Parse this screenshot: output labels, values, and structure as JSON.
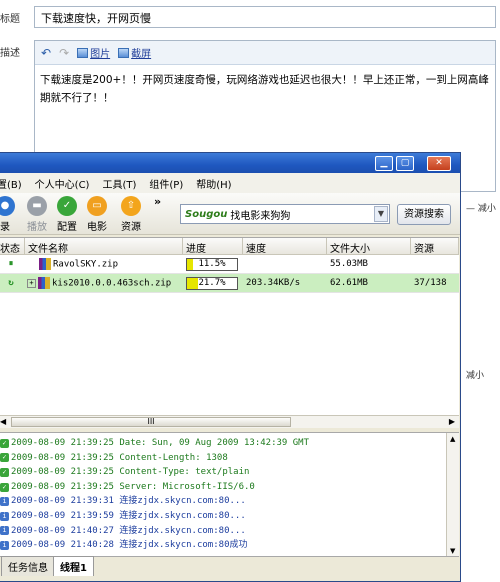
{
  "form": {
    "title_label": "标题",
    "title_value": "下载速度快，开网页慢",
    "desc_label": "描述",
    "image_link": "图片",
    "screenshot_link": "截屏",
    "desc_text": "下载速度是200+！！开网页速度奇慢，玩网络游戏也延迟也很大！！早上还正常，一到上网高峰期就不行了！！",
    "side_note_1": "— 减小",
    "side_note_2": "减小"
  },
  "window": {
    "menu": [
      "置(B)",
      "个人中心(C)",
      "工具(T)",
      "组件(P)",
      "帮助(H)"
    ],
    "toolbar": {
      "tools": [
        {
          "label": "录",
          "icon": "record-icon",
          "color": "#2f74d0"
        },
        {
          "label": "播放",
          "icon": "play-icon",
          "color": "#9aa0a8"
        },
        {
          "label": "配置",
          "icon": "config-icon",
          "color": "#39a63a"
        },
        {
          "label": "电影",
          "icon": "movie-icon",
          "color": "#f0a020"
        },
        {
          "label": "资源",
          "icon": "resource-icon",
          "color": "#f3a51c"
        }
      ],
      "more": "»",
      "search_brand": "Sougou",
      "search_text": "找电影来狗狗",
      "search_button": "资源搜索"
    },
    "columns": [
      "状态",
      "文件名称",
      "进度",
      "速度",
      "文件大小",
      "资源"
    ],
    "rows": [
      {
        "status": "⏸",
        "name": "RavolSKY.zip",
        "progress_text": "11.5%",
        "progress": 11.5,
        "speed": "",
        "size": "55.03MB",
        "sources": "",
        "selected": false
      },
      {
        "status": "↻",
        "name": "kis2010.0.0.463sch.zip",
        "progress_text": "21.7%",
        "progress": 21.7,
        "speed": "203.34KB/s",
        "size": "62.61MB",
        "sources": "37/138",
        "selected": true
      }
    ],
    "scroll_grip": "III",
    "log": [
      {
        "type": "green",
        "text": "2009-08-09 21:39:25 Date: Sun, 09 Aug 2009 13:42:39 GMT"
      },
      {
        "type": "green",
        "text": "2009-08-09 21:39:25 Content-Length: 1308"
      },
      {
        "type": "green",
        "text": "2009-08-09 21:39:25 Content-Type: text/plain"
      },
      {
        "type": "green",
        "text": "2009-08-09 21:39:25 Server: Microsoft-IIS/6.0"
      },
      {
        "type": "blue",
        "text": "2009-08-09 21:39:31 连接zjdx.skycn.com:80..."
      },
      {
        "type": "blue",
        "text": "2009-08-09 21:39:59 连接zjdx.skycn.com:80..."
      },
      {
        "type": "blue",
        "text": "2009-08-09 21:40:27 连接zjdx.skycn.com:80..."
      },
      {
        "type": "blue",
        "text": "2009-08-09 21:40:28 连接zjdx.skycn.com:80成功"
      }
    ],
    "tabs": [
      "任务信息",
      "线程1"
    ]
  }
}
